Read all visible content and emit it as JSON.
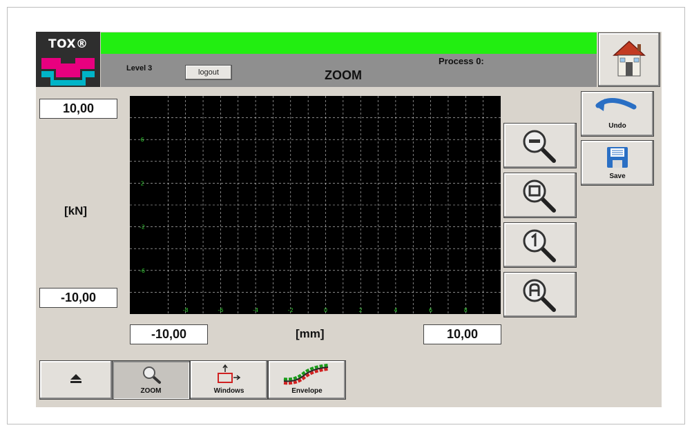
{
  "header": {
    "logo_text": "TOX®",
    "level": "Level 3",
    "logout_label": "logout",
    "title": "ZOOM",
    "process": "Process 0:"
  },
  "axes": {
    "y_max": "10,00",
    "y_min": "-10,00",
    "y_unit": "[kN]",
    "x_min": "-10,00",
    "x_max": "10,00",
    "x_unit": "[mm]"
  },
  "chart_data": {
    "type": "line",
    "series": [],
    "xlim": [
      -10,
      10
    ],
    "ylim": [
      -10,
      10
    ],
    "x_ticks": [
      "-8",
      "-6",
      "-4",
      "-2",
      "0",
      "2",
      "4",
      "6",
      "8"
    ],
    "y_ticks": [
      "6",
      "2",
      "-2",
      "-6"
    ],
    "grid": true
  },
  "side_buttons": {
    "undo_label": "Undo",
    "save_label": "Save"
  },
  "bottom_tabs": {
    "zoom_label": "ZOOM",
    "windows_label": "Windows",
    "envelope_label": "Envelope"
  },
  "colors": {
    "status_bar": "#22ee11",
    "plot_background": "#000000",
    "tick_label": "#33cc33",
    "grid": "#ffffff"
  }
}
